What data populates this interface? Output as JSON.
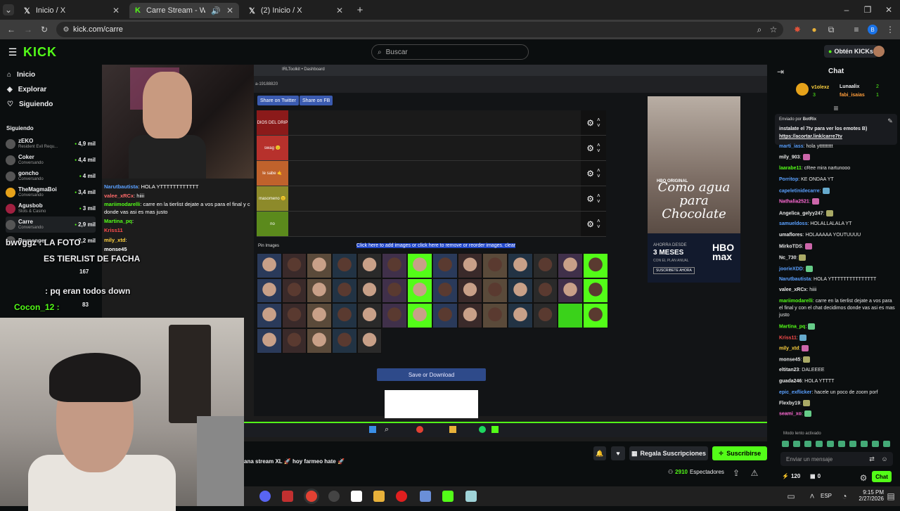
{
  "browser": {
    "tabs": [
      {
        "label": "Inicio / X"
      },
      {
        "label": "Carre Stream - Watch Live o"
      },
      {
        "label": "(2) Inicio / X"
      }
    ],
    "url": "kick.com/carre",
    "profile_letter": "B"
  },
  "kick": {
    "logo": "KICK",
    "search_placeholder": "Buscar",
    "get_kicks": "Obtén KICKs",
    "nav": [
      {
        "label": "Inicio",
        "icon": "home-icon"
      },
      {
        "label": "Explorar",
        "icon": "compass-icon"
      },
      {
        "label": "Siguiendo",
        "icon": "heart-icon"
      }
    ],
    "following_title": "Siguiendo",
    "following": [
      {
        "name": "zEKO",
        "sub": "Resident Evil Requ...",
        "viewers": "4,9 mil"
      },
      {
        "name": "Coker",
        "sub": "Conversando",
        "viewers": "4,4 mil"
      },
      {
        "name": "goncho",
        "sub": "Conversando",
        "viewers": "4 mil"
      },
      {
        "name": "TheMagmaBoi",
        "sub": "Conversando",
        "viewers": "3,4 mil"
      },
      {
        "name": "Agusbob",
        "sub": "Slots & Casino",
        "viewers": "3 mil"
      },
      {
        "name": "Carre",
        "sub": "Conversando",
        "viewers": "2,9 mil"
      },
      {
        "name": "Brunenger",
        "sub": "",
        "viewers": "2,2 mil"
      }
    ]
  },
  "stream_overlay": {
    "chat_lines": [
      {
        "user": "Narutbautista",
        "text": ": HOLA YTTTTTTTTTTTT"
      },
      {
        "user": "valee_xRCx",
        "text": ": hiiii"
      },
      {
        "user": "mariimodarelli",
        "text": ": carre en la tierlist dejate a vos para el final y c"
      },
      {
        "user": "",
        "text": "donde vas asi es mas justo"
      },
      {
        "user": "Martina_pq",
        "text": ":"
      },
      {
        "user": "Kriss11",
        "text": ""
      },
      {
        "user": "mily_xtd",
        "text": ":"
      },
      {
        "user": "monse45",
        "text": ""
      }
    ],
    "big_lines": [
      {
        "text": "bwvggz : LA FOTO"
      },
      {
        "text": "ES TIERLIST DE FACHA"
      },
      {
        "text": ": pq eran todos down"
      },
      {
        "text": "Cocon_12 :"
      }
    ],
    "side_counts": [
      "167",
      "83"
    ]
  },
  "inner_browser": {
    "tab": "IRLToolkit • Dashboard",
    "url_fragment": "a-19188820",
    "share_twitter": "Share on Twitter",
    "share_fb": "Share on FB",
    "tiers": [
      {
        "label": "DIOS DEL DRIP",
        "color": "#8b1a1a"
      },
      {
        "label": "swag 🙂",
        "color": "#b7312c"
      },
      {
        "label": "le sabe 🤙",
        "color": "#c0622c"
      },
      {
        "label": "masomeno 😐",
        "color": "#8d8a2a"
      },
      {
        "label": "no",
        "color": "#5b8a1c"
      }
    ],
    "pin_images": "Pin Images",
    "add_images": "Click here to add images or click here to remove or reorder images. clear",
    "save_button": "Save or Download",
    "face_count": 47
  },
  "ad": {
    "title": "Como agua para Chocolate",
    "brand": "HBO ORIGINAL",
    "promo_line1": "AHORRA DESDE",
    "promo_line2": "3 MESES",
    "promo_line3": "CON EL PLAN ANUAL",
    "promo_cta": "SUSCRIBETE AHORA",
    "logo": "HBO max"
  },
  "stream_info": {
    "title": "ana stream XL 🚀 hoy farmeo hate 🚀",
    "gift_subs": "Regala Suscripciones",
    "subscribe": "Suscribirse",
    "viewers": "2910",
    "viewers_label": "Espectadores"
  },
  "chat": {
    "title": "Chat",
    "top_gifters": [
      {
        "name": "v1olexz",
        "count": "3"
      },
      {
        "name": "Lunaalix",
        "count": "2"
      },
      {
        "name": "fabi_isaias",
        "count": "1"
      }
    ],
    "pinned_by": "Enviado por",
    "pinned_user": "BotRix",
    "pinned_text": "instalate el 7tv para ver los emotes B)",
    "pinned_link": "https://acortar.link/carre7tv",
    "messages": [
      {
        "user": "marti_iass",
        "text": ": hola ytttttttttt",
        "color": "#5aa0ff"
      },
      {
        "user": "mily_903",
        "text": ":",
        "color": "#e8e8e8"
      },
      {
        "user": "laarabe11",
        "text": ": cRee mira nartunooo",
        "color": "#53fc18"
      },
      {
        "user": "Porritop",
        "text": ": KE ONDAA YT",
        "color": "#5aa0ff"
      },
      {
        "user": "capeletinidecarre",
        "text": ":",
        "color": "#5aa0ff"
      },
      {
        "user": "Nathalia2521",
        "text": ":",
        "color": "#ff6ad5"
      },
      {
        "user": "Angelica_gelyy247",
        "text": ":",
        "color": "#e8e8e8"
      },
      {
        "user": "samueldoss",
        "text": ": HOLALLALALA YT",
        "color": "#5aa0ff"
      },
      {
        "user": "umaflores",
        "text": ": HOLAAAAA YOUTUUUU",
        "color": "#e8e8e8"
      },
      {
        "user": "MirkoTDS",
        "text": ":",
        "color": "#e8e8e8"
      },
      {
        "user": "Nc_730",
        "text": ":",
        "color": "#e8e8e8"
      },
      {
        "user": "joorieXDD",
        "text": ":",
        "color": "#5aa0ff"
      },
      {
        "user": "Narutbautista",
        "text": ": HOLA YTTTTTTTTTTTTTTT",
        "color": "#5aa0ff"
      },
      {
        "user": "valee_xRCx",
        "text": ": hiiii",
        "color": "#e8e8e8"
      },
      {
        "user": "mariimodarelli",
        "text": ": carre en la tierlist dejate a vos para el final y con el chat decidimos donde vas asi es mas justo",
        "color": "#53fc18"
      },
      {
        "user": "Martina_pq",
        "text": ":",
        "color": "#53fc18"
      },
      {
        "user": "Kriss11",
        "text": ":",
        "color": "#ff4d4d"
      },
      {
        "user": "mily_xtd",
        "text": ":",
        "color": "#ffd23f"
      },
      {
        "user": "monse45",
        "text": ":",
        "color": "#e8e8e8"
      },
      {
        "user": "eltitan23",
        "text": ": DALEEEE",
        "color": "#e8e8e8"
      },
      {
        "user": "guada246",
        "text": ": HOLA YTTTT",
        "color": "#e8e8e8"
      },
      {
        "user": "epic_exflicker",
        "text": ": hacele un poco de zoom porf",
        "color": "#5aa0ff"
      },
      {
        "user": "Flexby19",
        "text": ":",
        "color": "#e8e8e8"
      },
      {
        "user": "seami_xo",
        "text": ":",
        "color": "#ff6ad5"
      }
    ],
    "slow_mode": "Modo lento activado",
    "input_placeholder": "Enviar un mensaje",
    "kicks_count": "120",
    "gifts_count": "0",
    "send_label": "Chat"
  },
  "taskbar": {
    "lang": "ESP",
    "time": "9:15 PM",
    "date": "2/27/2026"
  }
}
